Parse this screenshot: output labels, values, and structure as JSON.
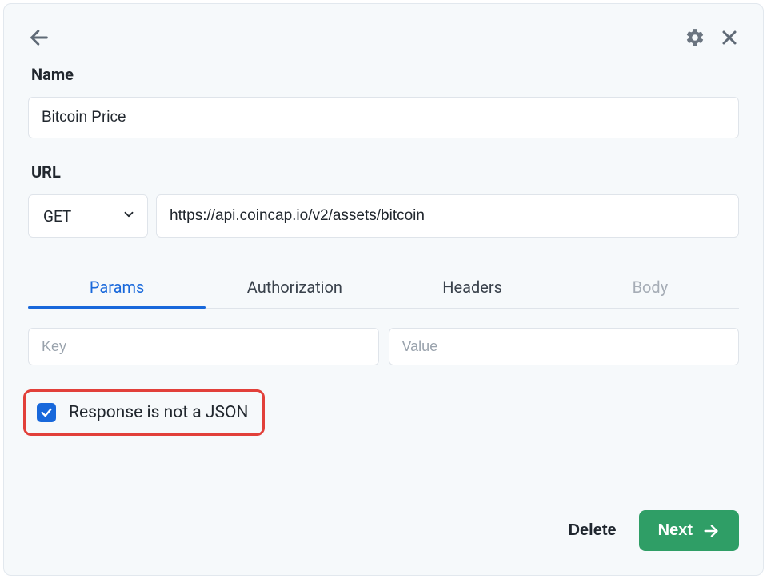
{
  "topbar": {
    "back_icon": "arrow-left",
    "settings_icon": "gear",
    "close_icon": "close"
  },
  "name": {
    "label": "Name",
    "value": "Bitcoin Price"
  },
  "url": {
    "label": "URL",
    "method": "GET",
    "value": "https://api.coincap.io/v2/assets/bitcoin"
  },
  "tabs": [
    {
      "label": "Params",
      "active": true,
      "disabled": false
    },
    {
      "label": "Authorization",
      "active": false,
      "disabled": false
    },
    {
      "label": "Headers",
      "active": false,
      "disabled": false
    },
    {
      "label": "Body",
      "active": false,
      "disabled": true
    }
  ],
  "kv": {
    "key_placeholder": "Key",
    "value_placeholder": "Value"
  },
  "checkbox": {
    "checked": true,
    "label": "Response is not a JSON"
  },
  "footer": {
    "delete_label": "Delete",
    "next_label": "Next"
  }
}
